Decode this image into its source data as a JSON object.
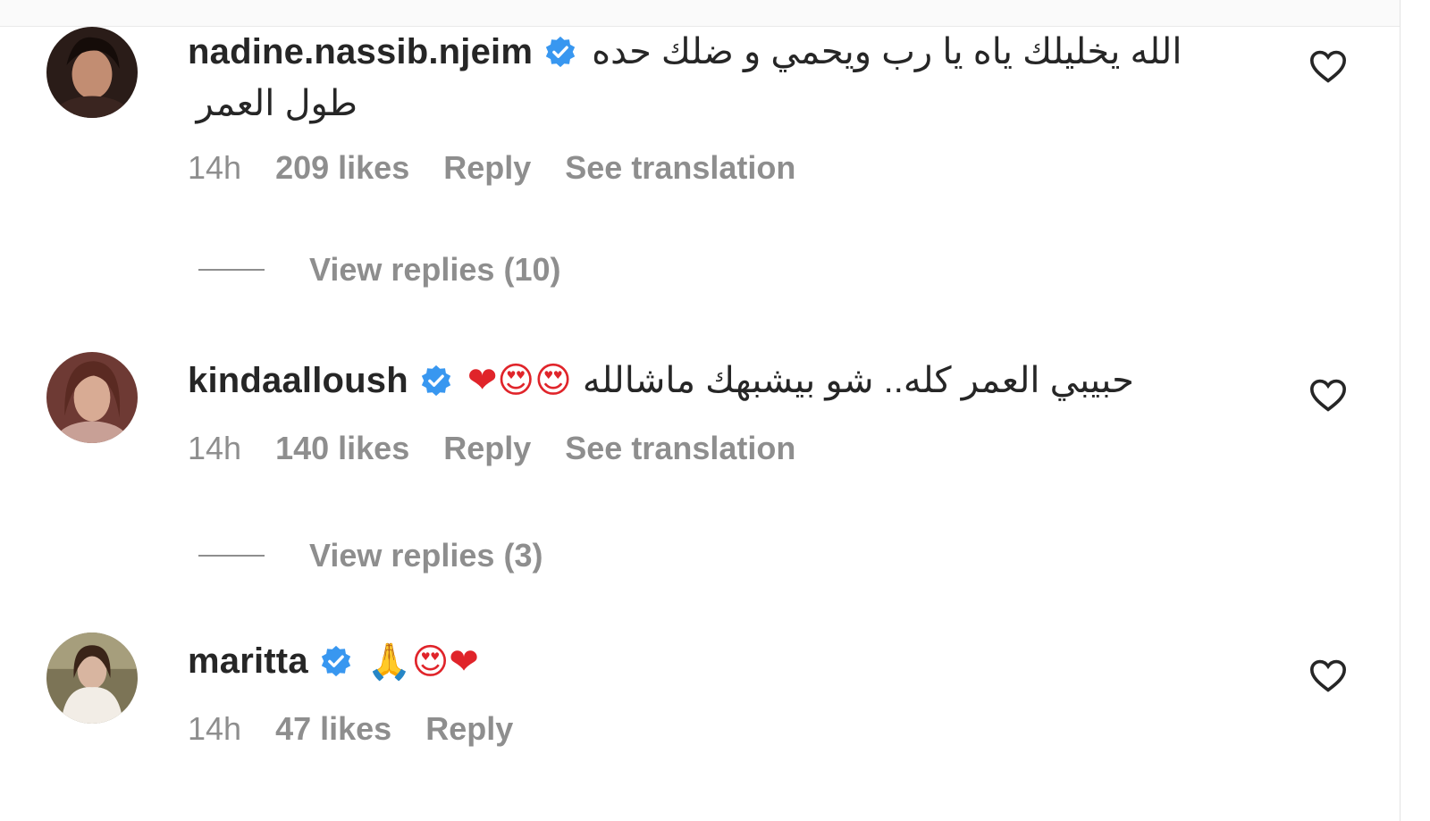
{
  "comments": [
    {
      "username": "nadine.nassib.njeim",
      "text_line1": "الله يخليلك ياه يا رب ويحمي و ضلك حده",
      "text_line2": "طول العمر",
      "emojis": "",
      "time": "14h",
      "likes": "209 likes",
      "reply_label": "Reply",
      "translation_label": "See translation",
      "view_replies": "View replies (10)"
    },
    {
      "username": "kindaalloush",
      "text_line1": "حبيبي العمر كله.. شو بيشبهك ماشالله",
      "text_line2": "",
      "emojis": "❤😍😍",
      "time": "14h",
      "likes": "140 likes",
      "reply_label": "Reply",
      "translation_label": "See translation",
      "view_replies": "View replies (3)"
    },
    {
      "username": "maritta",
      "text_line1": "",
      "text_line2": "",
      "emojis": "🙏😍❤",
      "time": "14h",
      "likes": "47 likes",
      "reply_label": "Reply",
      "translation_label": "",
      "view_replies": ""
    }
  ],
  "colors": {
    "verified": "#3897f0",
    "meta_text": "#8e8e8e",
    "primary_text": "#262626",
    "heart_red": "#e0242a"
  },
  "icons": {
    "verified": "verified-badge-icon",
    "like": "heart-outline-icon"
  }
}
